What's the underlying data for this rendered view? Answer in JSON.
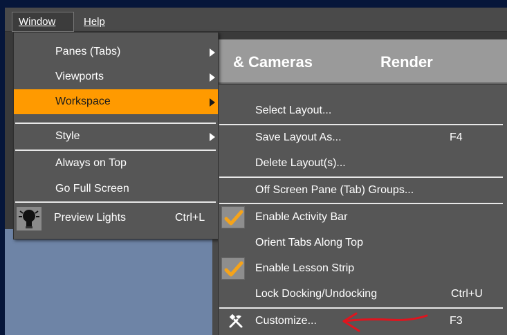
{
  "menubar": {
    "items": [
      {
        "label": "Window",
        "shortcut_letter": "W"
      },
      {
        "label": "Help",
        "shortcut_letter": "H"
      }
    ]
  },
  "background": {
    "tabs": [
      "& Cameras",
      "Render"
    ]
  },
  "window_menu": {
    "items": [
      {
        "label": "Panes (Tabs)",
        "submenu": true
      },
      {
        "label": "Viewports",
        "submenu": true
      },
      {
        "label": "Workspace",
        "submenu": true,
        "highlighted": true
      },
      {
        "label": "Style",
        "submenu": true
      },
      {
        "label": "Always on Top"
      },
      {
        "label": "Go Full Screen"
      },
      {
        "label": "Preview Lights",
        "shortcut": "Ctrl+L",
        "icon": "light-bulb-icon"
      }
    ]
  },
  "workspace_menu": {
    "items": [
      {
        "label": "Select Layout..."
      },
      {
        "label": "Save Layout As...",
        "shortcut": "F4"
      },
      {
        "label": "Delete Layout(s)..."
      },
      {
        "label": "Off Screen Pane (Tab) Groups..."
      },
      {
        "label": "Enable Activity Bar",
        "checked": true
      },
      {
        "label": "Orient Tabs Along Top"
      },
      {
        "label": "Enable Lesson Strip",
        "checked": true
      },
      {
        "label": "Lock Docking/Undocking",
        "shortcut": "Ctrl+U"
      },
      {
        "label": "Customize...",
        "shortcut": "F3",
        "icon": "tools-icon"
      }
    ]
  },
  "colors": {
    "highlight": "#ff9a00",
    "menu_bg": "#565656",
    "checkmark": "#f5a31a",
    "annotation_arrow": "#e0141e"
  }
}
